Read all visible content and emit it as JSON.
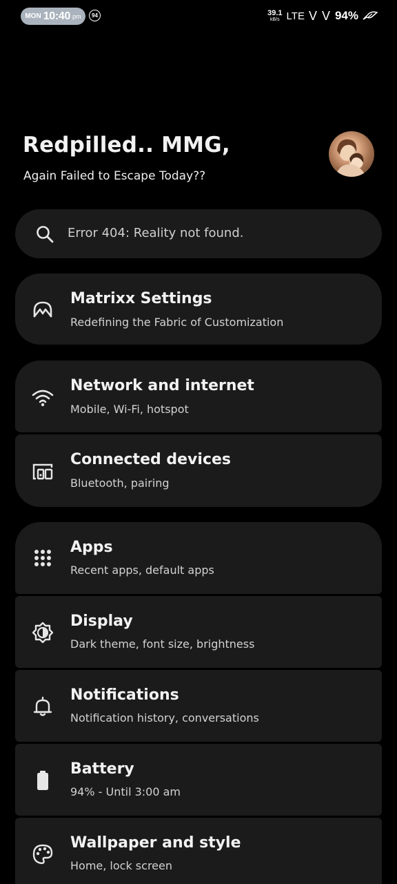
{
  "status_bar": {
    "day": "MON",
    "time": "10:40",
    "ampm": "pm",
    "notification_count": "94",
    "net_speed_value": "39.1",
    "net_speed_unit": "kB/s",
    "network_type": "LTE",
    "volte": "V V",
    "battery_percent": "94%"
  },
  "header": {
    "greeting": "Redpilled.. MMG,",
    "subtitle": "Again Failed to Escape Today??"
  },
  "search": {
    "text": "Error 404: Reality not found."
  },
  "settings": [
    {
      "title": "Matrixx Settings",
      "subtitle": "Redefining the Fabric of Customization",
      "icon": "matrixx-icon"
    },
    {
      "title": "Network and internet",
      "subtitle": "Mobile, Wi-Fi, hotspot",
      "icon": "wifi-icon"
    },
    {
      "title": "Connected devices",
      "subtitle": "Bluetooth, pairing",
      "icon": "devices-icon"
    },
    {
      "title": "Apps",
      "subtitle": "Recent apps, default apps",
      "icon": "apps-grid-icon"
    },
    {
      "title": "Display",
      "subtitle": "Dark theme, font size, brightness",
      "icon": "brightness-icon"
    },
    {
      "title": "Notifications",
      "subtitle": "Notification history, conversations",
      "icon": "bell-icon"
    },
    {
      "title": "Battery",
      "subtitle": "94% - Until 3:00 am",
      "icon": "battery-icon"
    },
    {
      "title": "Wallpaper and style",
      "subtitle": "Home, lock screen",
      "icon": "palette-icon"
    }
  ],
  "colors": {
    "background": "#000000",
    "card": "#1b1b1b",
    "clock_pill": "#aab3bd"
  }
}
